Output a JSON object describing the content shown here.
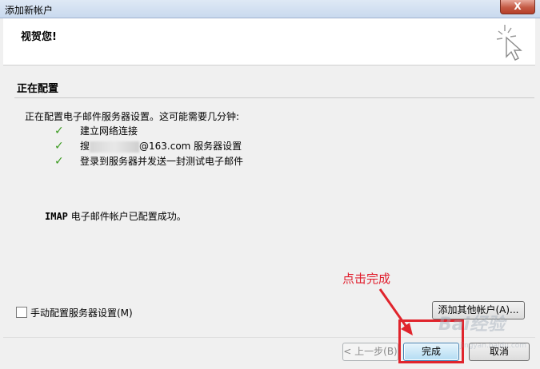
{
  "window": {
    "title": "添加新帐户",
    "close_label": "X"
  },
  "header": {
    "title": "视贺您!"
  },
  "section": {
    "title": "正在配置",
    "intro": "正在配置电子邮件服务器设置。这可能需要几分钟:",
    "steps": [
      {
        "check": "✓",
        "label": "建立网络连接"
      },
      {
        "check": "✓",
        "prefix": "搜",
        "suffix": "@163.com 服务器设置"
      },
      {
        "check": "✓",
        "label": "登录到服务器并发送一封测试电子邮件"
      }
    ],
    "success_prefix": "IMAP",
    "success_text": " 电子邮件帐户已配置成功。"
  },
  "footer": {
    "manual_config_label": "手动配置服务器设置(M)",
    "add_other_account_label": "添加其他帐户(A)...",
    "back_label": "< 上一步(B)",
    "finish_label": "完成",
    "cancel_label": "取消"
  },
  "annotation": {
    "text": "点击完成",
    "color": "#e01b2a"
  },
  "watermark": {
    "text": "Bai经验",
    "url": "jingyan.baidu.com"
  }
}
